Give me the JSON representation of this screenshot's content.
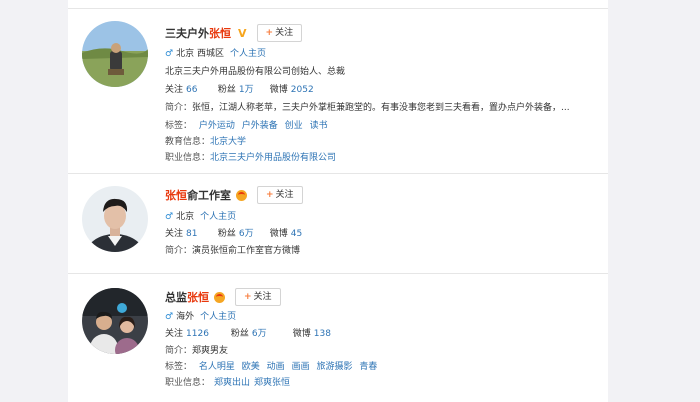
{
  "users": [
    {
      "name_prefix": "三夫户外",
      "name_highlight": "张恒",
      "name_suffix": "",
      "verified_badge": "V",
      "follow_label": "关注",
      "location": "北京 西城区",
      "homepage": "个人主页",
      "desc": "北京三夫户外用品股份有限公司创始人、总裁",
      "follow_label_text": "关注",
      "follow_count": "66",
      "fans_label": "粉丝",
      "fans_count": "1万",
      "weibo_label": "微博",
      "weibo_count": "2052",
      "intro_label": "简介：",
      "intro": "张恒，江湖人称老苹，三夫户外掌柜兼跑堂的。有事没事您老到三夫看看，置办点户外装备，...",
      "tags_label": "标签：",
      "tags": [
        "户外运动",
        "户外装备",
        "创业",
        "读书"
      ],
      "edu_label": "教育信息：",
      "edu": "北京大学",
      "job_label": "职业信息：",
      "job": "北京三夫户外用品股份有限公司"
    },
    {
      "name_prefix": "",
      "name_highlight": "张恒",
      "name_suffix": "俞工作室",
      "follow_label": "关注",
      "location": "北京",
      "homepage": "个人主页",
      "follow_label_text": "关注",
      "follow_count": "81",
      "fans_label": "粉丝",
      "fans_count": "6万",
      "weibo_label": "微博",
      "weibo_count": "45",
      "intro_label": "简介：",
      "intro": "演员张恒俞工作室官方微博"
    },
    {
      "name_prefix": "总监",
      "name_highlight": "张恒",
      "name_suffix": "",
      "follow_label": "关注",
      "location": "海外",
      "homepage": "个人主页",
      "follow_label_text": "关注",
      "follow_count": "1126",
      "fans_label": "粉丝",
      "fans_count": "6万",
      "weibo_label": "微博",
      "weibo_count": "138",
      "intro_label": "简介：",
      "intro": "郑爽男友",
      "tags_label": "标签：",
      "tags": [
        "名人明星",
        "欧美",
        "动画",
        "画画",
        "旅游摄影",
        "青春"
      ],
      "job_label": "职业信息：",
      "job_items": [
        "郑爽出山",
        "郑爽张恒"
      ]
    }
  ]
}
